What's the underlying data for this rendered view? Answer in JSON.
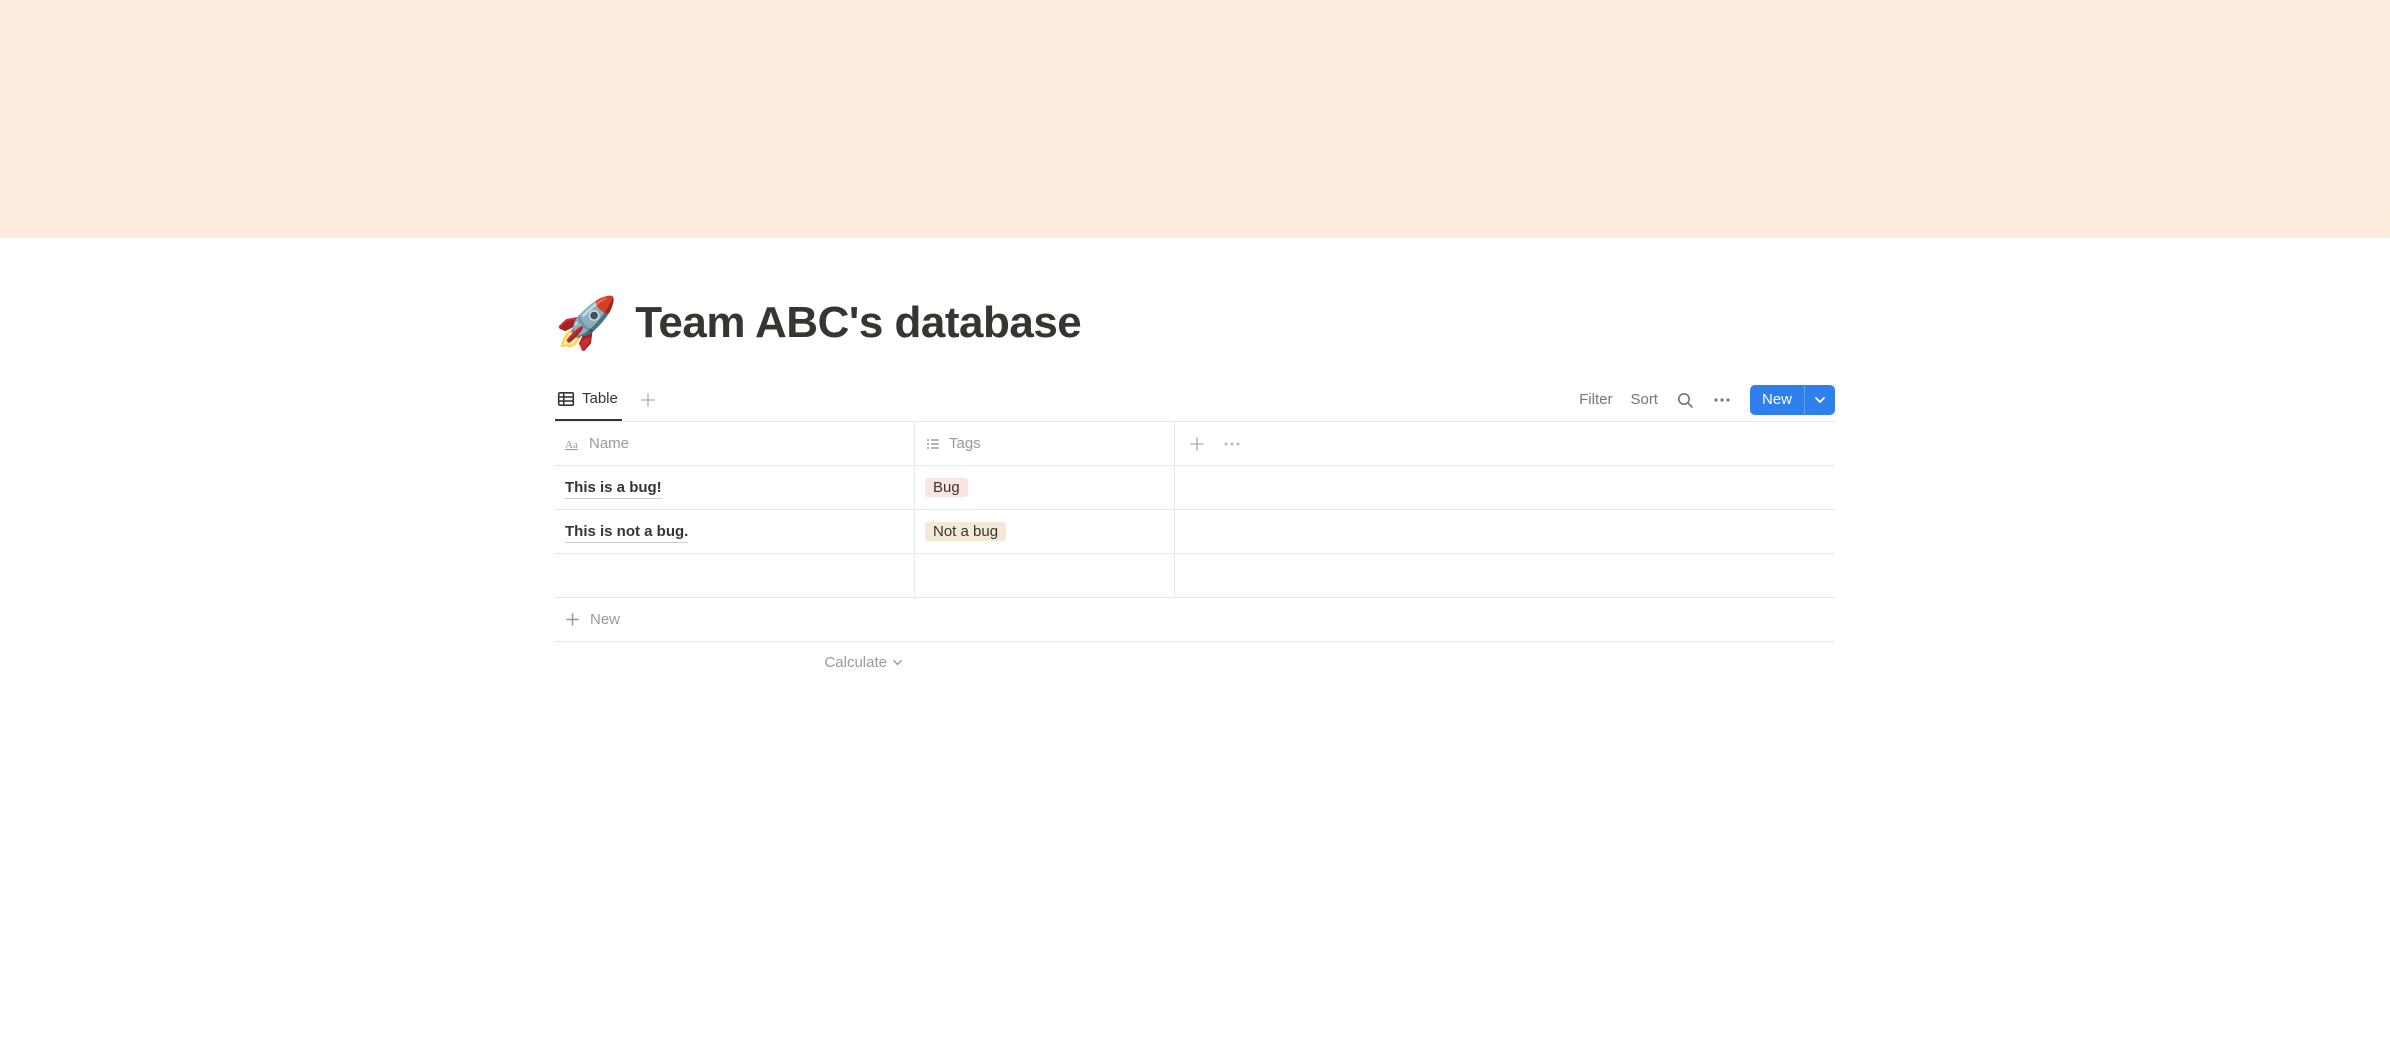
{
  "page": {
    "icon": "🚀",
    "title": "Team ABC's database"
  },
  "viewbar": {
    "tab_label": "Table",
    "filter_label": "Filter",
    "sort_label": "Sort",
    "new_button_label": "New"
  },
  "columns": {
    "name_label": "Name",
    "tags_label": "Tags"
  },
  "rows": [
    {
      "name": "This is a bug!",
      "tag": {
        "label": "Bug",
        "color": "#fbe4e4"
      }
    },
    {
      "name": "This is not a bug.",
      "tag": {
        "label": "Not a bug",
        "color": "#f4e8d9"
      }
    }
  ],
  "footer": {
    "new_row_label": "New",
    "calculate_label": "Calculate"
  }
}
